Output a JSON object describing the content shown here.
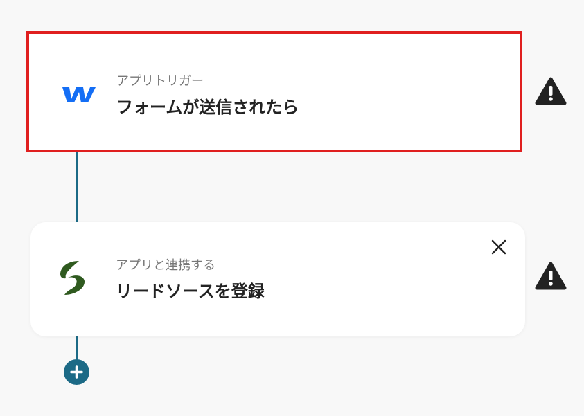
{
  "flow": {
    "trigger": {
      "subtitle": "アプリトリガー",
      "title": "フォームが送信されたら",
      "app_icon": "webflow-logo-icon",
      "border_color": "#e01f1f",
      "icon_color": "#146ef5"
    },
    "action": {
      "subtitle": "アプリと連携する",
      "title": "リードソースを登録",
      "app_icon": "leadsource-logo-icon",
      "icon_color": "#2f5a1f"
    },
    "connector_color": "#1c6a86",
    "add_step_icon": "plus-icon",
    "warning_icon": "warning-icon"
  }
}
